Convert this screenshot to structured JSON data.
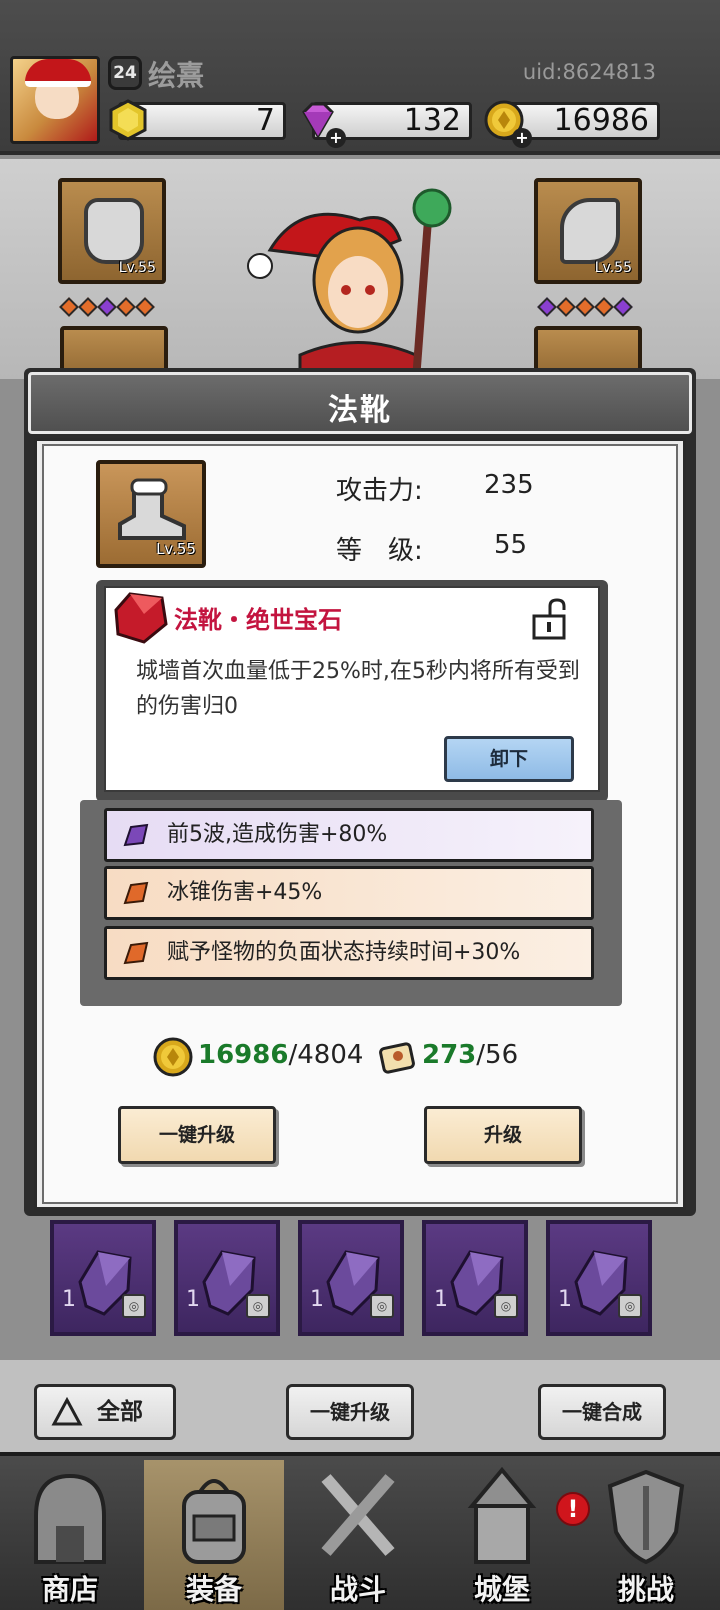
{
  "header": {
    "level": "24",
    "player_name": "绘熹",
    "uid": "uid:8624813",
    "resources": [
      {
        "name": "yellow-gem",
        "value": "7",
        "color": "#e3c52a"
      },
      {
        "name": "purple-diamond",
        "value": "132",
        "color": "#c75bd6"
      },
      {
        "name": "gold-coin",
        "value": "16986",
        "color": "#d8a81c"
      }
    ]
  },
  "equipment": {
    "slots": [
      {
        "label": "Lv.55"
      },
      {
        "label": "Lv.55"
      }
    ]
  },
  "modal": {
    "title": "法靴",
    "item_level_label": "Lv.55",
    "stats": {
      "attack_label": "攻击力:",
      "attack_value": "235",
      "level_label": "等　级:",
      "level_value": "55"
    },
    "gem": {
      "title": "法靴・绝世宝石",
      "description": "城墙首次血量低于25%时,在5秒内将所有受到的伤害归0",
      "unequip_label": "卸下"
    },
    "buffs": [
      {
        "text": "前5波,造成伤害+80%",
        "tone": "purple"
      },
      {
        "text": "冰锥伤害+45%",
        "tone": "orange"
      },
      {
        "text": "赋予怪物的负面状态持续时间+30%",
        "tone": "orange"
      }
    ],
    "cost": {
      "coin_have": "16986",
      "coin_need": "/4804",
      "scroll_have": "273",
      "scroll_need": "/56"
    },
    "buttons": {
      "auto_upgrade": "一键升级",
      "upgrade": "升级"
    }
  },
  "gem_grid": {
    "cells": [
      {
        "count": "1"
      },
      {
        "count": "1"
      },
      {
        "count": "1"
      },
      {
        "count": "1"
      },
      {
        "count": "1"
      }
    ]
  },
  "actions": {
    "all": "全部",
    "auto_upgrade": "一键升级",
    "auto_merge": "一键合成"
  },
  "nav": {
    "items": [
      {
        "label": "商店"
      },
      {
        "label": "装备"
      },
      {
        "label": "战斗"
      },
      {
        "label": "城堡"
      },
      {
        "label": "挑战"
      }
    ],
    "alert": "!"
  }
}
